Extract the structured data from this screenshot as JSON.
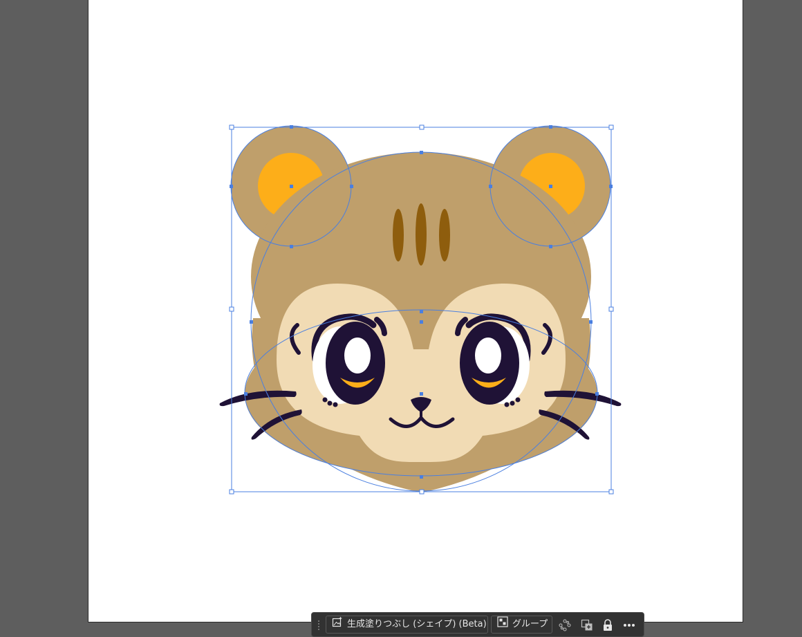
{
  "canvas": {
    "background_color": "#5e5e5e",
    "artboard_color": "#ffffff"
  },
  "artwork": {
    "subject": "cartoon hamster/cat face",
    "colors": {
      "fur": "#bf9f6b",
      "inner_ear": "#fdae19",
      "muzzle": "#f1dbb4",
      "stripes": "#8e5d0d",
      "eyes_and_whiskers": "#1f1236",
      "eye_highlight": "#ffffff",
      "eye_reflection": "#fdae19",
      "selection": "#4a7fe0"
    }
  },
  "contextual_taskbar": {
    "generative_fill_label": "生成塗りつぶし (シェイプ) (Beta)",
    "group_label": "グループ",
    "icons": [
      "generative-fill-icon",
      "group-icon",
      "recolor-icon",
      "duplicate-icon",
      "lock-icon",
      "more-options-icon"
    ]
  }
}
